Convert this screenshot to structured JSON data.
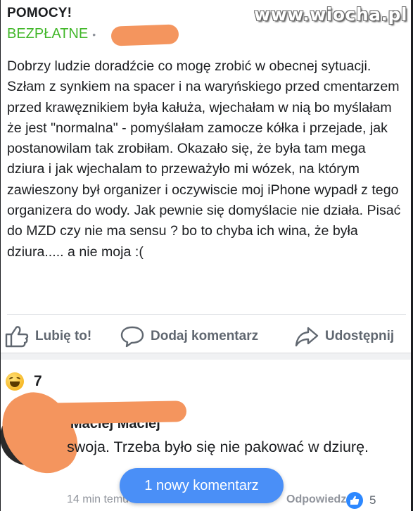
{
  "post": {
    "title": "POMOCY!",
    "subtitle": "BEZPŁATNE",
    "body": "Dobrzy ludzie doradźcie co mogę zrobić w obecnej sytuacji. Szłam z synkiem na spacer i na waryńskiego przed cmentarzem przed krawęznikiem była kałuża, wjechałam w nią bo myślałam że jest \"normalna\" - pomyślałam zamocze kółka i przejade, jak postanowilam tak zrobiłam. Okazało się, że była tam mega dziura i jak wjechalam to przeważyło mi wózek, na którym zawieszony był organizer i oczywiscie moj iPhone wypadł z tego organizera do wody. Jak pewnie się domyślacie nie działa. Pisać do MZD czy nie ma sensu ? bo to chyba ich wina, że była dziura..... a nie moja :("
  },
  "watermark": "www.wiocha.pl",
  "actions": {
    "like": "Lubię to!",
    "comment": "Dodaj komentarz",
    "share": "Udostępnij"
  },
  "reactions": {
    "emoji": "laughing-emoji",
    "count": "7"
  },
  "comment": {
    "author": "Maciej Maciej",
    "text": "swoja. Trzeba było się nie pakować w dziurę.",
    "time": "14 min temu",
    "reply": "Odpowiedz",
    "likes": "5"
  },
  "new_comment_pill": "1 nowy komentarz",
  "colors": {
    "accent_green": "#42b72a",
    "link_blue": "#2d88ff",
    "pill_blue": "#4a8ff7",
    "redaction_orange": "#f4955e"
  }
}
